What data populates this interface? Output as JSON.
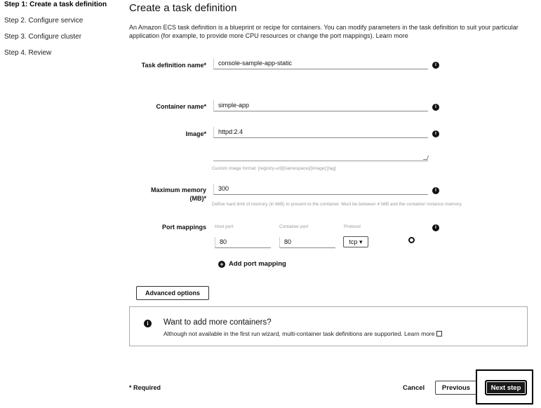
{
  "steps": [
    {
      "label": "Step 1: Create a task definition"
    },
    {
      "label": "Step 2. Configure service"
    },
    {
      "label": "Step 3. Configure cluster"
    },
    {
      "label": "Step 4. Review"
    }
  ],
  "page": {
    "title": "Create a task definition",
    "intro": "An Amazon ECS task definition is a blueprint or recipe for containers. You can modify parameters in the task definition to suit your particular application (for example, to provide more CPU resources or change the port mappings). Learn more"
  },
  "form": {
    "task_def_name": {
      "label": "Task definition name*",
      "value": "console-sample-app-static"
    },
    "container_name": {
      "label": "Container name*",
      "value": "simple-app"
    },
    "image": {
      "label": "Image*",
      "value": "httpd:2.4",
      "hint": "Custom image format: [registry-url]/[namespace]/[image]:[tag]"
    },
    "max_memory": {
      "label_line1": "Maximum memory",
      "label_line2": "(MB)*",
      "value": "300",
      "hint": "Define hard limit of memory (in MiB) to present to the container. Must be between 4 MiB and the container instance memory."
    },
    "port_mappings": {
      "label": "Port mappings",
      "host_port_header": "Host port",
      "container_port_header": "Container port",
      "protocol_header": "Protocol",
      "host_port": "80",
      "container_port": "80",
      "protocol": "tcp"
    },
    "add_port_mapping": "Add port mapping",
    "advanced_options": "Advanced options",
    "info_glyph": "i"
  },
  "notice": {
    "title": "Want to add more containers?",
    "text": "Although not available in the first run wizard, multi-container task definitions are supported. Learn more"
  },
  "footer": {
    "required": "* Required",
    "cancel": "Cancel",
    "previous": "Previous",
    "next": "Next step"
  }
}
